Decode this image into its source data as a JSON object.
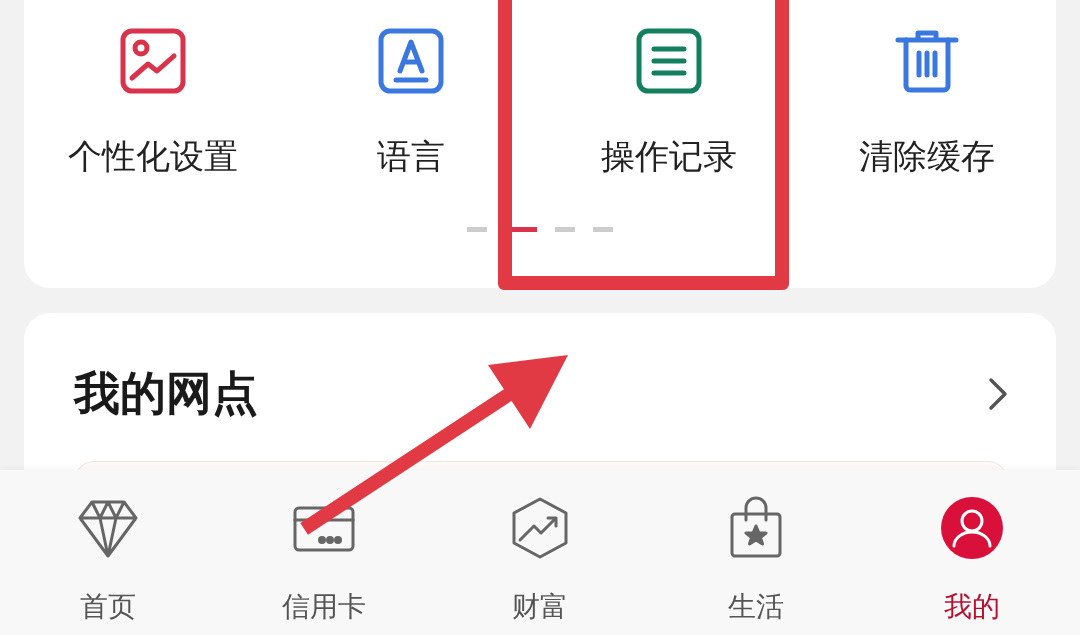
{
  "shortcuts": [
    {
      "kind": "picture",
      "label": "个性化设置",
      "color": "#d9324a"
    },
    {
      "kind": "letter",
      "label": "语言",
      "color": "#3a78e0"
    },
    {
      "kind": "list",
      "label": "操作记录",
      "color": "#12805c"
    },
    {
      "kind": "trash",
      "label": "清除缓存",
      "color": "#3a78e0"
    }
  ],
  "pager": [
    {
      "selected": false
    },
    {
      "selected": true
    },
    {
      "selected": false
    },
    {
      "selected": false
    }
  ],
  "branch_card": {
    "title": "我的网点"
  },
  "tab_bar": [
    {
      "kind": "diamond",
      "label": "首页",
      "selected": false
    },
    {
      "kind": "card",
      "label": "信用卡",
      "selected": false
    },
    {
      "kind": "chart",
      "label": "财富",
      "selected": false
    },
    {
      "kind": "bag",
      "label": "生活",
      "selected": false
    },
    {
      "kind": "person",
      "label": "我的",
      "selected": true
    }
  ],
  "annotations": {
    "highlight_box": true,
    "arrow": true
  }
}
